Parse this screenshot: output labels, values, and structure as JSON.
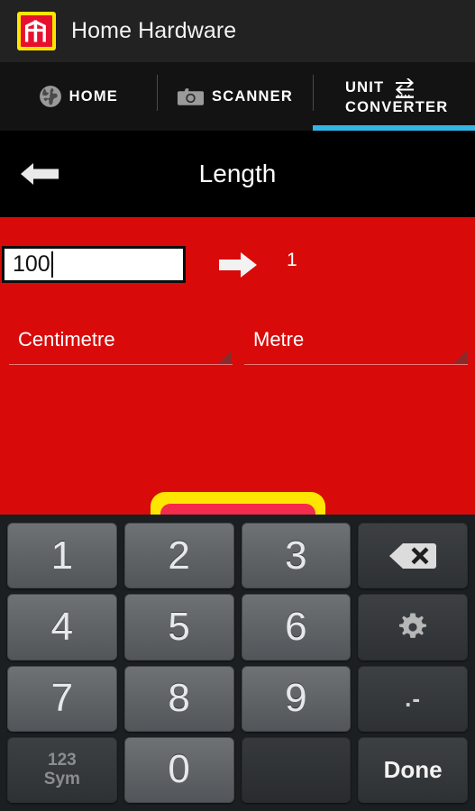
{
  "app": {
    "title": "Home Hardware",
    "logo_icon": "home-hardware-logo",
    "logo_border_color": "#FFE600",
    "logo_fill_color": "#E8112D"
  },
  "tabs": [
    {
      "label": "HOME",
      "icon": "globe-icon",
      "active": false
    },
    {
      "label": "SCANNER",
      "icon": "camera-icon",
      "active": false
    },
    {
      "label_line1": "UNIT",
      "label_line2": "CONVERTER",
      "icon": "swap-arrows-icon",
      "active": true,
      "indicator_color": "#33b5e5"
    }
  ],
  "subheader": {
    "back_icon": "back-arrow-icon",
    "title": "Length"
  },
  "converter": {
    "input_value": "100",
    "input_placeholder": "",
    "arrow_icon": "right-arrow-icon",
    "result_value": "1",
    "from_unit": "Centimetre",
    "to_unit": "Metre",
    "dropdown_icon": "spinner-caret-icon",
    "background_color": "#D90A0A"
  },
  "action_button": {
    "outline_color": "#FFE600",
    "fill_color": "#F42B4B"
  },
  "keyboard": {
    "keys": [
      {
        "label": "1",
        "type": "num",
        "name": "key-1"
      },
      {
        "label": "2",
        "type": "num",
        "name": "key-2"
      },
      {
        "label": "3",
        "type": "num",
        "name": "key-3"
      },
      {
        "label": "",
        "type": "fn",
        "name": "key-backspace",
        "icon": "backspace-icon"
      },
      {
        "label": "4",
        "type": "num",
        "name": "key-4"
      },
      {
        "label": "5",
        "type": "num",
        "name": "key-5"
      },
      {
        "label": "6",
        "type": "num",
        "name": "key-6"
      },
      {
        "label": "",
        "type": "fn",
        "name": "key-settings",
        "icon": "gear-icon"
      },
      {
        "label": "7",
        "type": "num",
        "name": "key-7"
      },
      {
        "label": "8",
        "type": "num",
        "name": "key-8"
      },
      {
        "label": "9",
        "type": "num",
        "name": "key-9"
      },
      {
        "label": ".-",
        "type": "fn",
        "name": "key-dot-dash"
      },
      {
        "label_line1": "123",
        "label_line2": "Sym",
        "type": "fn",
        "name": "key-symbols"
      },
      {
        "label": "0",
        "type": "num",
        "name": "key-0"
      },
      {
        "label": "",
        "type": "blank",
        "name": "key-blank"
      },
      {
        "label": "Done",
        "type": "fn",
        "name": "key-done"
      }
    ]
  }
}
